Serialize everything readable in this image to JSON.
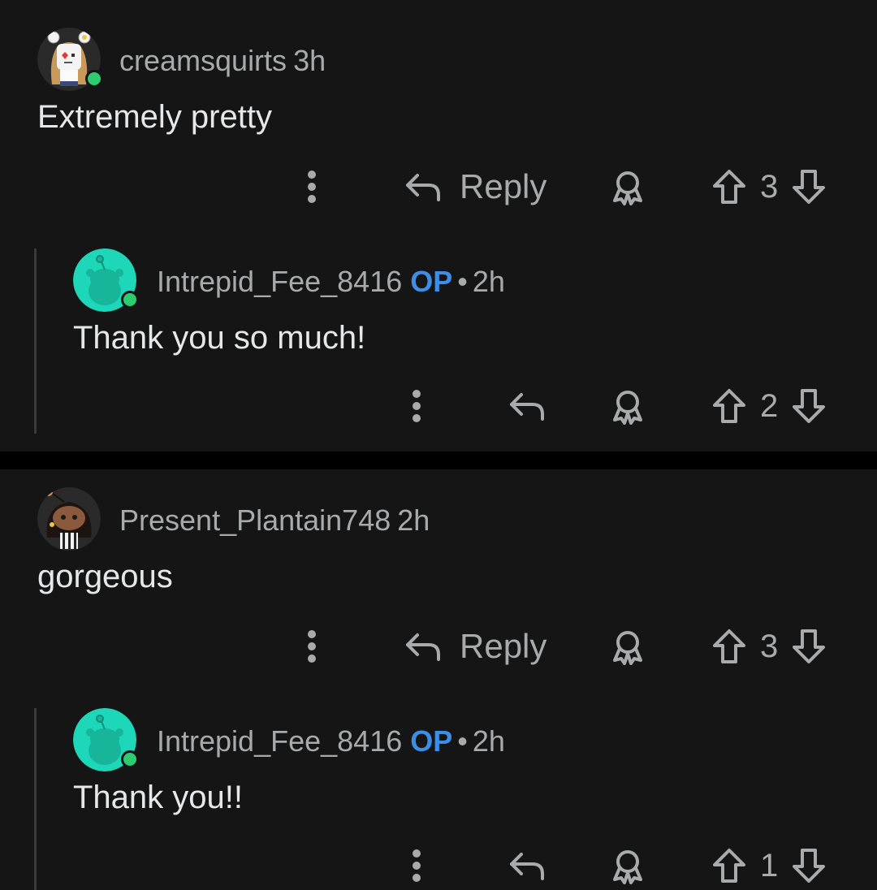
{
  "threads": [
    {
      "comment": {
        "username": "creamsquirts",
        "time": "3h",
        "body": "Extremely pretty",
        "reply_label": "Reply",
        "score": "3",
        "avatar_icon": "snoo-avatar-icon"
      },
      "reply": {
        "username": "Intrepid_Fee_8416",
        "op_badge": "OP",
        "separator": "•",
        "time": "2h",
        "body": "Thank you so much!",
        "score": "2",
        "avatar_icon": "default-snoo-avatar-icon"
      }
    },
    {
      "comment": {
        "username": "Present_Plantain748",
        "time": "2h",
        "body": "gorgeous",
        "reply_label": "Reply",
        "score": "3",
        "avatar_icon": "snoo-avatar-icon"
      },
      "reply": {
        "username": "Intrepid_Fee_8416",
        "op_badge": "OP",
        "separator": "•",
        "time": "2h",
        "body": "Thank you!!",
        "score": "1",
        "avatar_icon": "default-snoo-avatar-icon"
      }
    }
  ],
  "colors": {
    "background": "#151515",
    "separator": "#000000",
    "op_blue": "#3d8ee6",
    "online_green": "#2ecc71",
    "avatar_teal": "#1ed7b8"
  }
}
